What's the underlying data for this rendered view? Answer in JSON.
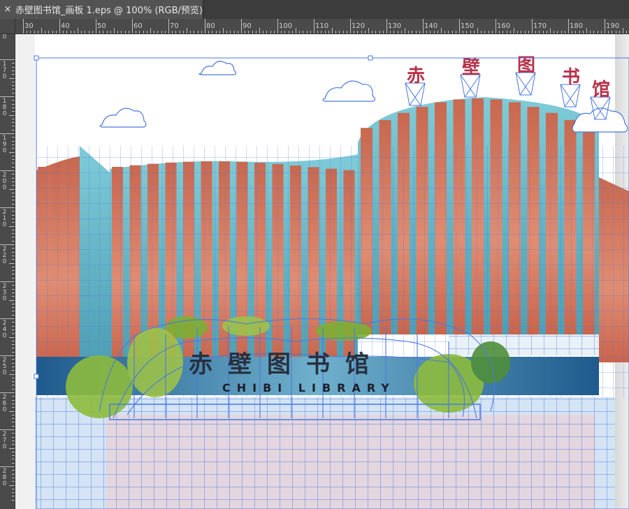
{
  "document_tab": {
    "close_glyph": "×",
    "title": "赤壁图书馆_画板 1.eps @ 100% (RGB/预览)"
  },
  "rulers": {
    "horizontal": [
      "30",
      "40",
      "50",
      "60",
      "70",
      "80",
      "90",
      "100",
      "110",
      "120",
      "130",
      "140",
      "150",
      "160",
      "170",
      "180",
      "190"
    ],
    "vertical": [
      "170",
      "180",
      "190",
      "200",
      "210",
      "220",
      "230",
      "240",
      "250",
      "260",
      "270",
      "280"
    ],
    "origin": "0"
  },
  "artwork": {
    "rooftop_chars": [
      "赤",
      "壁",
      "图",
      "书",
      "馆"
    ],
    "sign_cn": "赤壁图书馆",
    "sign_en": "CHIBI LIBRARY",
    "colors": {
      "selection": "#4a78e0",
      "facade_red": "#c8705a",
      "facade_glass": "#7fcbd8",
      "tree_green": "#8dbb3d",
      "plaza": "#e3d6df"
    }
  }
}
